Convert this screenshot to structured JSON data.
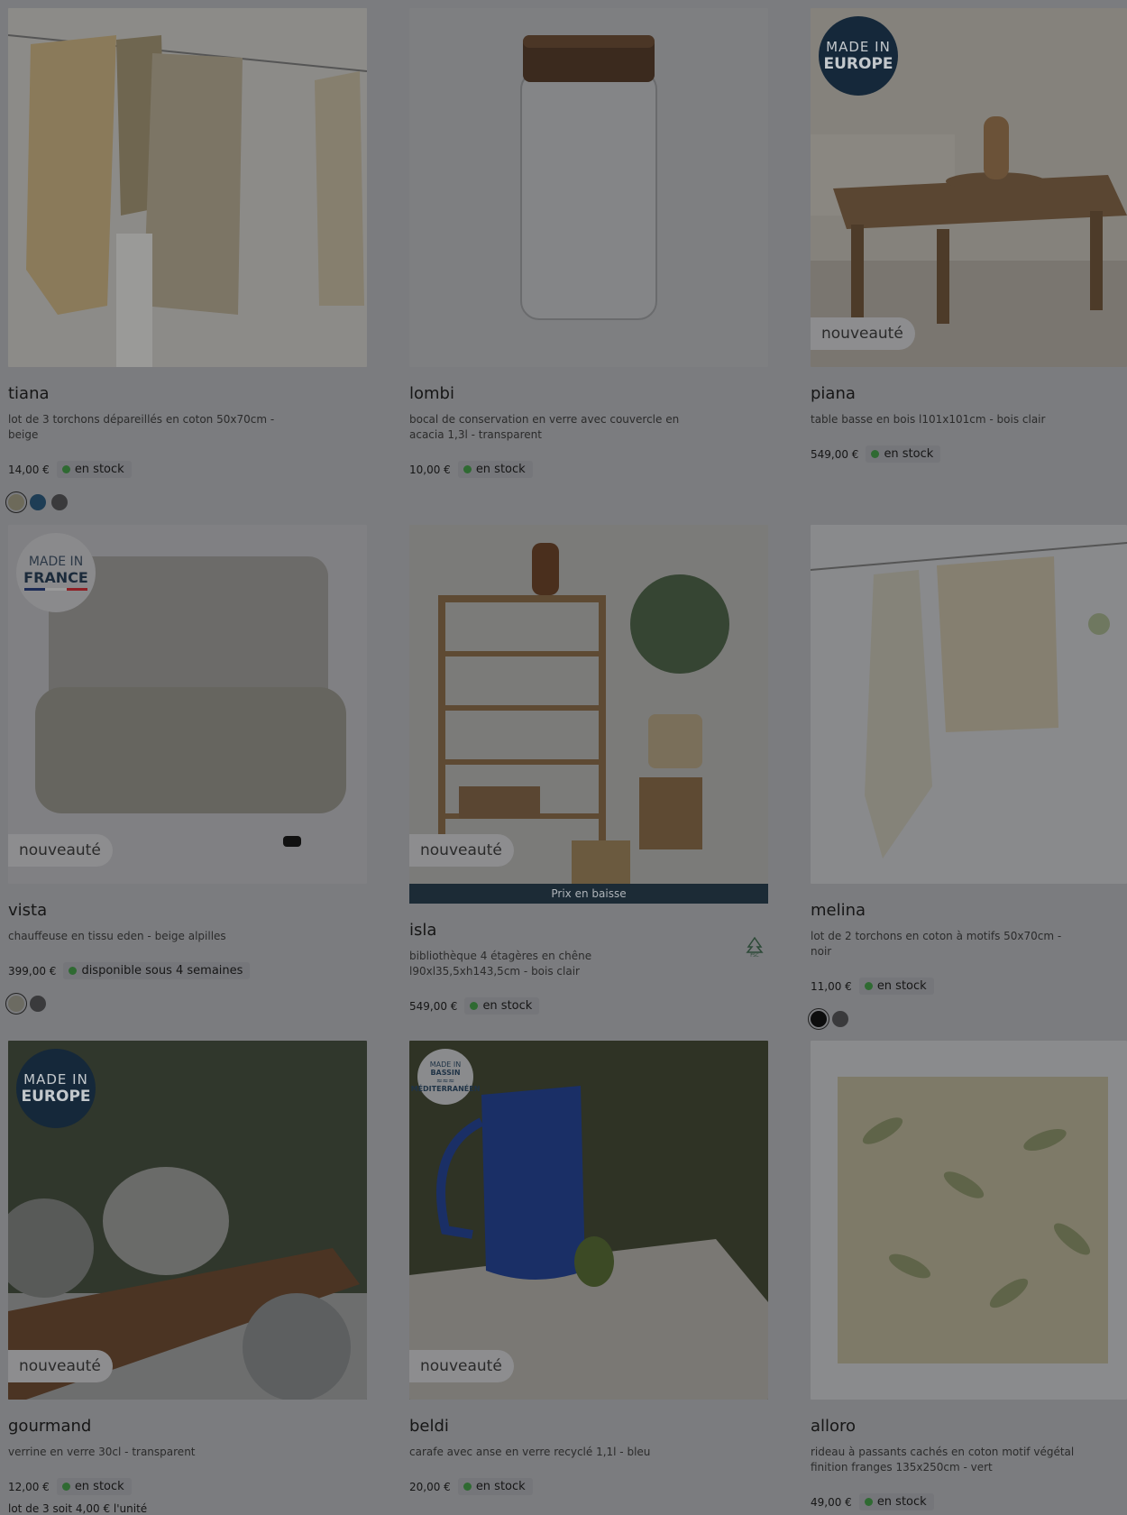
{
  "products": [
    {
      "name": "tiana",
      "desc": "lot de 3 torchons dépareillés en coton 50x70cm - beige",
      "price": "14,00 €",
      "stock": "en stock",
      "badge": "",
      "circle": "",
      "swatches": [
        "#6d6a5a",
        "#1e3d55",
        "#3a3a3c"
      ]
    },
    {
      "name": "lombi",
      "desc": "bocal de conservation en verre avec couvercle en acacia 1,3l - transparent",
      "price": "10,00 €",
      "stock": "en stock",
      "badge": "",
      "circle": "",
      "swatches": []
    },
    {
      "name": "piana",
      "desc": "table basse en bois l101x101cm - bois clair",
      "price": "549,00 €",
      "stock": "en stock",
      "badge": "nouveauté",
      "circle": "MADE IN EUROPE",
      "swatches": []
    },
    {
      "name": "vista",
      "desc": "chauffeuse en tissu eden - beige alpilles",
      "price": "399,00 €",
      "stock": "disponible sous 4 semaines",
      "badge": "nouveauté",
      "circle": "MADE IN FRANCE",
      "swatches": [
        "#6c6b62",
        "#3a3a3c"
      ]
    },
    {
      "name": "isla",
      "desc": "bibliothèque 4 étagères en chêne l90xl35,5xh143,5cm - bois clair",
      "price": "549,00 €",
      "stock": "en stock",
      "badge": "nouveauté",
      "circle": "",
      "ribbon": "Prix en baisse",
      "swatches": []
    },
    {
      "name": "melina",
      "desc": "lot de 2 torchons en coton à motifs 50x70cm - noir",
      "price": "11,00 €",
      "stock": "en stock",
      "badge": "",
      "circle": "",
      "swatches": [
        "#0d0d0d",
        "#3a3a3c"
      ]
    },
    {
      "name": "gourmand",
      "desc": "verrine en verre 30cl - transparent",
      "price": "12,00 €",
      "stock": "en stock",
      "badge": "nouveauté",
      "circle": "MADE IN EUROPE",
      "extra": "lot de 3 soit 4,00 € l'unité",
      "swatches": []
    },
    {
      "name": "beldi",
      "desc": "carafe avec anse en verre recyclé 1,1l - bleu",
      "price": "20,00 €",
      "stock": "en stock",
      "badge": "nouveauté",
      "circle": "MADE IN BASSIN MÉDITERRANÉEN",
      "swatches": []
    },
    {
      "name": "alloro",
      "desc": "rideau à passants cachés en coton motif végétal finition franges 135x250cm - vert",
      "price": "49,00 €",
      "stock": "en stock",
      "badge": "",
      "circle": "",
      "swatches": []
    }
  ],
  "colors": {
    "overlay": "#7b7c7f",
    "ribbon": "#1c2b36",
    "stock_dot": "#2f6a32"
  },
  "icons": {
    "isla": "fsc-tree-icon"
  }
}
